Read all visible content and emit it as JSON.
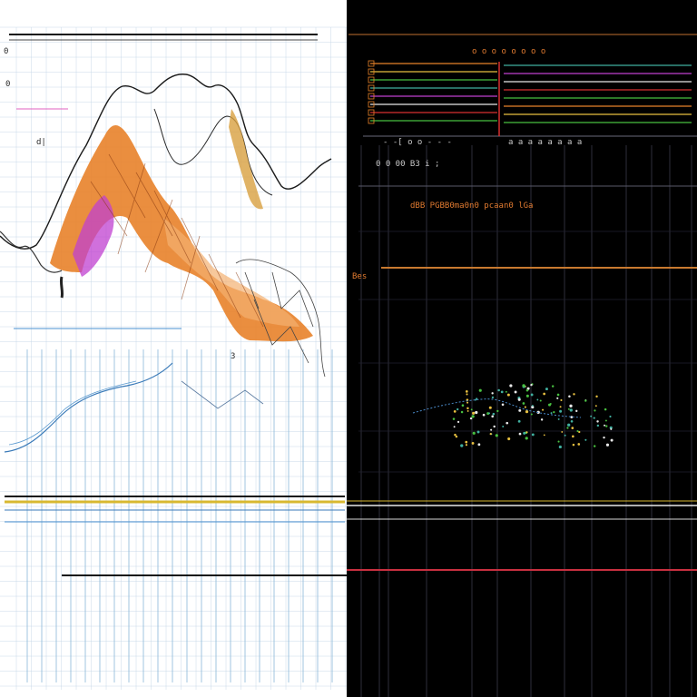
{
  "panels": {
    "left": {
      "background": "#ffffff",
      "grid_color": "#c8d8e8",
      "ink": "#1a1a1a"
    },
    "right": {
      "background": "#000000",
      "grid_color": "#3a3a4a"
    }
  },
  "colors": {
    "orange": "#e8822a",
    "orange_light": "#f4b070",
    "magenta": "#c040d0",
    "blue": "#3a7ab8",
    "yellow": "#e8c040",
    "red": "#d83030",
    "green": "#48c040",
    "teal": "#40b0a0",
    "white": "#e8e8e8"
  },
  "glyphs": {
    "left_top_tick": "0",
    "left_mid_tick": "0",
    "left_small_mark": "d|",
    "left_bottom_mark": "3",
    "right_label_a": "0 0 00 B3 i ;",
    "right_label_b": "Bes",
    "right_row_scribble": "dBB PGBB0ma0n0 pcaan0 lGa",
    "right_readout": "- -[ o  o -  - -",
    "right_bar_text": "a a a a   a a  a a",
    "right_header_text": "o o o  o o o  o o"
  }
}
